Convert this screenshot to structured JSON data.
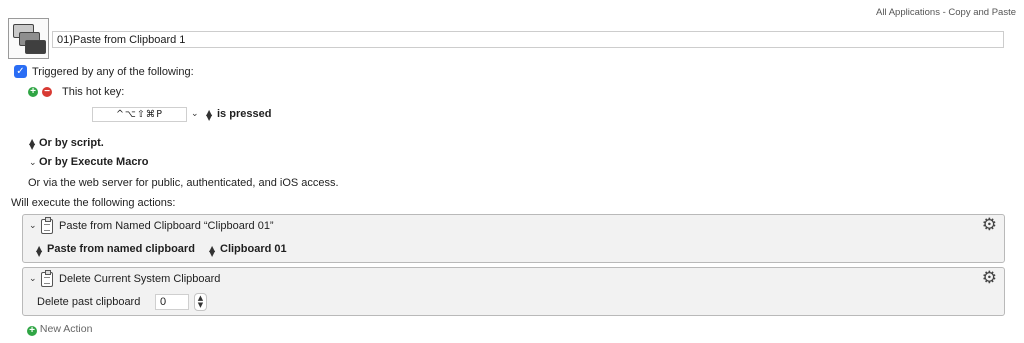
{
  "header": {
    "group_label": "All Applications - Copy and Paste"
  },
  "macro": {
    "name": "01)Paste from Clipboard 1"
  },
  "triggers": {
    "checkbox_label": "Triggered by any of the following:",
    "hotkey_label": "This hot key:",
    "hotkey_value": "^⌥⇧⌘P",
    "hotkey_condition": "is pressed",
    "or_script": "Or by script.",
    "or_execute_macro": "Or by Execute Macro",
    "web_server": "Or via the web server for public, authenticated, and iOS access."
  },
  "actions_header": "Will execute the following actions:",
  "actions": [
    {
      "title": "Paste from Named Clipboard “Clipboard 01”",
      "option1": "Paste from named clipboard",
      "option2": "Clipboard 01"
    },
    {
      "title": "Delete Current System Clipboard",
      "field_label": "Delete past clipboard",
      "field_value": "0"
    }
  ],
  "footer": {
    "new_action": "New Action"
  },
  "icons": {
    "macro": "macro-clipboard-stack-icon",
    "action": "clipboard-icon",
    "gear": "gear-icon",
    "add": "plus-circle-icon",
    "remove": "minus-circle-icon"
  },
  "colors": {
    "accent": "#2a6df4",
    "add": "#2fa544",
    "remove": "#d83a33"
  }
}
